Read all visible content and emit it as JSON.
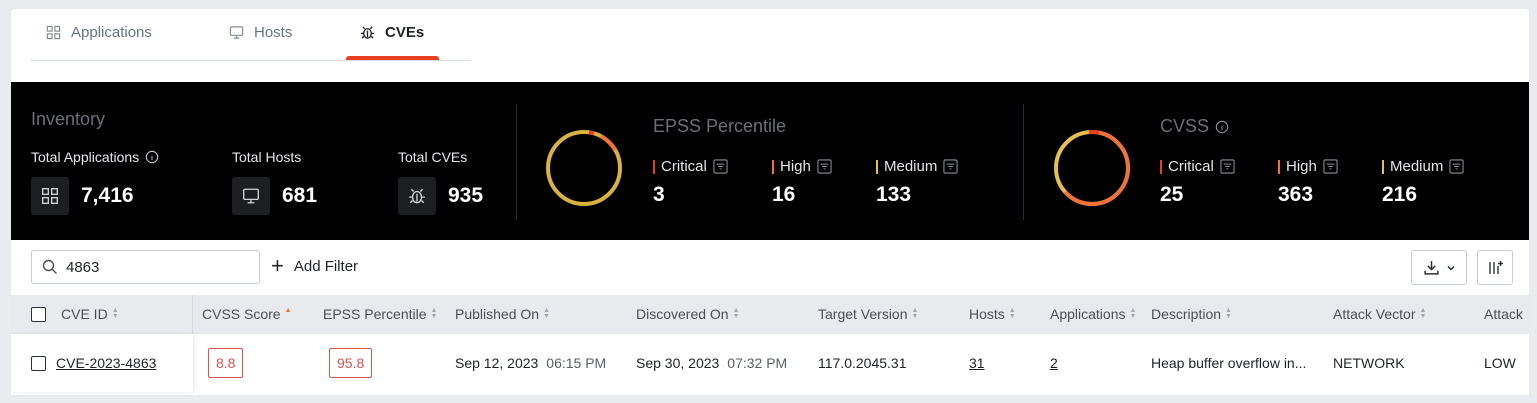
{
  "tabs": [
    {
      "label": "Applications",
      "icon": "grid-icon"
    },
    {
      "label": "Hosts",
      "icon": "monitor-icon"
    },
    {
      "label": "CVEs",
      "icon": "bug-icon",
      "active": true
    }
  ],
  "colors": {
    "accent": "#e8401f",
    "critical": "#e8401f",
    "high": "#f07236",
    "medium": "#e5c04a",
    "ring_base": "#d9b23f"
  },
  "inventory": {
    "title": "Inventory",
    "applications": {
      "label": "Total Applications",
      "value": "7,416"
    },
    "hosts": {
      "label": "Total Hosts",
      "value": "681"
    },
    "cves": {
      "label": "Total CVEs",
      "value": "935"
    }
  },
  "epss": {
    "title": "EPSS Percentile",
    "critical": {
      "label": "Critical",
      "value": "3"
    },
    "high": {
      "label": "High",
      "value": "16"
    },
    "medium": {
      "label": "Medium",
      "value": "133"
    }
  },
  "cvss": {
    "title": "CVSS",
    "critical": {
      "label": "Critical",
      "value": "25"
    },
    "high": {
      "label": "High",
      "value": "363"
    },
    "medium": {
      "label": "Medium",
      "value": "216"
    }
  },
  "toolbar": {
    "search_value": "4863",
    "add_filter_label": "Add Filter"
  },
  "table": {
    "columns": [
      "CVE ID",
      "CVSS Score",
      "EPSS Percentile",
      "Published On",
      "Discovered On",
      "Target Version",
      "Hosts",
      "Applications",
      "Description",
      "Attack Vector",
      "Attack"
    ],
    "rows": [
      {
        "cve_id": "CVE-2023-4863",
        "cvss_score": "8.8",
        "epss_percentile": "95.8",
        "published_date": "Sep 12, 2023",
        "published_time": "06:15 PM",
        "discovered_date": "Sep 30, 2023",
        "discovered_time": "07:32 PM",
        "target_version": "117.0.2045.31",
        "hosts": "31",
        "applications": "2",
        "description": "Heap buffer overflow in...",
        "attack_vector": "NETWORK",
        "attack": "LOW"
      }
    ]
  }
}
